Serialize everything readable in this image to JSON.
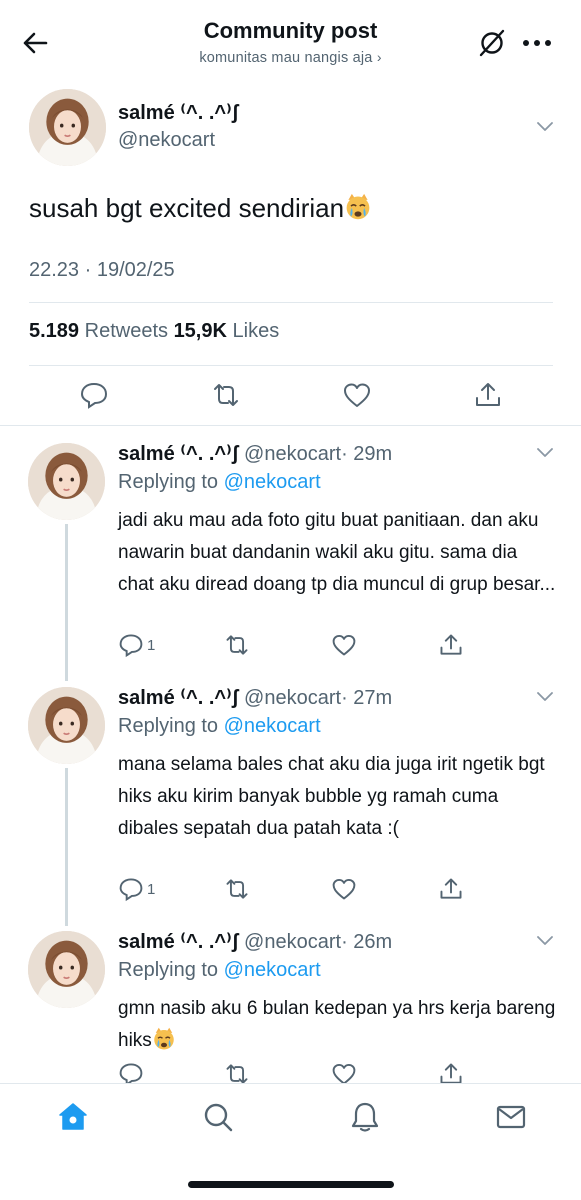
{
  "header": {
    "title": "Community post",
    "subtitle": "komunitas mau nangis aja",
    "subtitle_chevron": "›"
  },
  "main_post": {
    "name": "salmé ⁽^. .^⁾ʃ",
    "handle": "@nekocart",
    "text": "susah bgt excited sendirian",
    "emoji": "crying-cat-emoji",
    "timestamp": "22.23 · 19/02/25",
    "retweets_count": "5.189",
    "retweets_label": "Retweets",
    "likes_count": "15,9K",
    "likes_label": "Likes"
  },
  "replies": [
    {
      "name": "salmé ⁽^. .^⁾ʃ",
      "handle": "@nekocart",
      "time": "· 29m",
      "replying_label": "Replying to",
      "replying_to": "@nekocart",
      "text": "jadi aku mau ada foto gitu buat panitiaan. dan aku nawarin buat dandanin wakil aku gitu. sama dia chat aku diread doang tp dia muncul di grup besar...",
      "reply_count": "1"
    },
    {
      "name": "salmé ⁽^. .^⁾ʃ",
      "handle": "@nekocart",
      "time": "· 27m",
      "replying_label": "Replying to",
      "replying_to": "@nekocart",
      "text": "mana selama bales chat aku dia juga irit ngetik bgt hiks aku kirim banyak bubble yg ramah cuma dibales sepatah dua patah kata :(",
      "reply_count": "1"
    },
    {
      "name": "salmé ⁽^. .^⁾ʃ",
      "handle": "@nekocart",
      "time": "· 26m",
      "replying_label": "Replying to",
      "replying_to": "@nekocart",
      "text": "gmn nasib aku 6 bulan kedepan ya hrs kerja bareng hiks",
      "emoji": "crying-cat-emoji",
      "reply_count": ""
    }
  ],
  "tabbar": {
    "items": [
      "home-icon",
      "search-icon",
      "notifications-bell-icon",
      "messages-envelope-icon"
    ],
    "active": "home-icon"
  },
  "colors": {
    "accent": "#1d9bf0",
    "text": "#0f1419",
    "secondary": "#536471",
    "divider": "#e1e8ed"
  }
}
